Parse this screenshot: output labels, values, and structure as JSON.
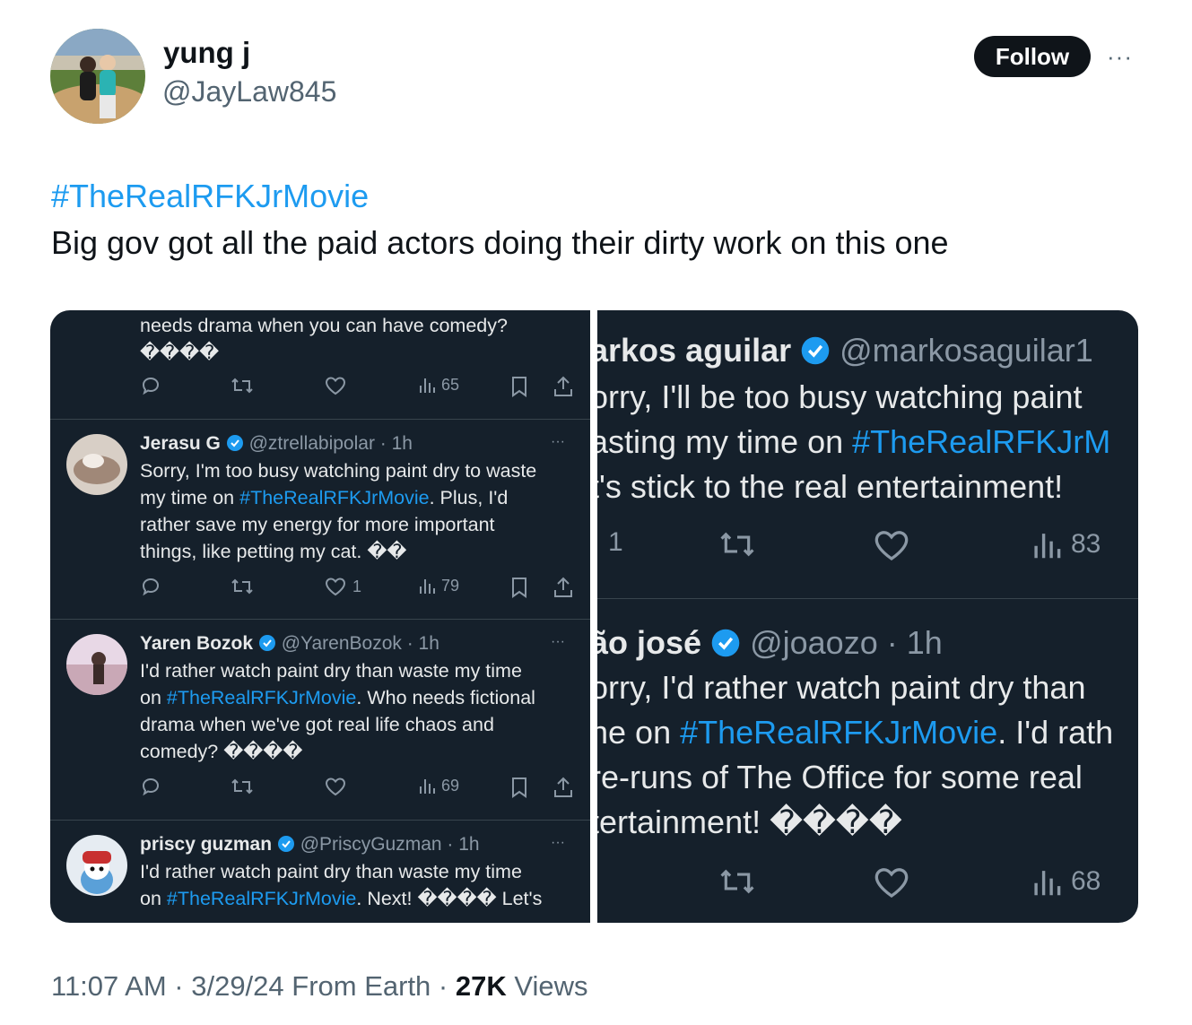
{
  "author": {
    "display_name": "yung j",
    "handle": "@JayLaw845",
    "follow_label": "Follow",
    "more_label": "···"
  },
  "tweet": {
    "hashtag": "#TheRealRFKJrMovie",
    "text": "Big gov got all the paid actors doing their dirty work on this one"
  },
  "left_screenshot": {
    "top_fragment": {
      "line1": "needs drama when you can have comedy?",
      "line2": "����",
      "views": "65"
    },
    "tweets": [
      {
        "name": "Jerasu G",
        "handle_time": "@ztrellabipolar · 1h",
        "lines": [
          {
            "pre": "Sorry, I'm too busy watching paint dry to waste",
            "tag": "",
            "post": ""
          },
          {
            "pre": "my time on ",
            "tag": "#TheRealRFKJrMovie",
            "post": ". Plus, I'd"
          },
          {
            "pre": "rather save my energy for more important",
            "tag": "",
            "post": ""
          },
          {
            "pre": "things, like petting my cat. ��",
            "tag": "",
            "post": ""
          }
        ],
        "likes": "1",
        "views": "79"
      },
      {
        "name": "Yaren Bozok",
        "handle_time": "@YarenBozok · 1h",
        "lines": [
          {
            "pre": "I'd rather watch paint dry than waste my time",
            "tag": "",
            "post": ""
          },
          {
            "pre": "on ",
            "tag": "#TheRealRFKJrMovie",
            "post": ". Who needs fictional"
          },
          {
            "pre": "drama when we've got real life chaos and",
            "tag": "",
            "post": ""
          },
          {
            "pre": "comedy? ����",
            "tag": "",
            "post": ""
          }
        ],
        "views": "69"
      },
      {
        "name": "priscy guzman",
        "handle_time": "@PriscyGuzman · 1h",
        "lines": [
          {
            "pre": "I'd rather watch paint dry than waste my time",
            "tag": "",
            "post": ""
          },
          {
            "pre": "on ",
            "tag": "#TheRealRFKJrMovie",
            "post": ". Next! ���� Let's"
          }
        ]
      }
    ],
    "dots": "···"
  },
  "right_screenshot": {
    "tweets": [
      {
        "name": "arkos aguilar",
        "handle_time": "@markosaguilar1",
        "lines": [
          {
            "pre": "orry, I'll be too busy watching paint",
            "tag": "",
            "post": ""
          },
          {
            "pre": "asting my time on ",
            "tag": "#TheRealRFKJrM",
            "post": ""
          },
          {
            "pre": "t's stick to the real entertainment!",
            "tag": "",
            "post": ""
          }
        ],
        "replies": "1",
        "views": "83"
      },
      {
        "name": "ão josé",
        "handle_time": "@joaozo · 1h",
        "lines": [
          {
            "pre": "orry, I'd rather watch paint dry than",
            "tag": "",
            "post": ""
          },
          {
            "pre": "ne on ",
            "tag": "#TheRealRFKJrMovie",
            "post": ". I'd rath"
          },
          {
            "pre": " re-runs of The Office for some real",
            "tag": "",
            "post": ""
          },
          {
            "pre": "tertainment! ����",
            "tag": "",
            "post": ""
          }
        ],
        "views": "68"
      }
    ]
  },
  "footer": {
    "time_date": "11:07 AM · 3/29/24 From Earth · ",
    "views_count": "27K",
    "views_label": " Views"
  },
  "colors": {
    "link": "#1d9bf0",
    "dark_bg": "#15202b",
    "muted": "#8b98a5",
    "verified": "#1d9bf0"
  }
}
